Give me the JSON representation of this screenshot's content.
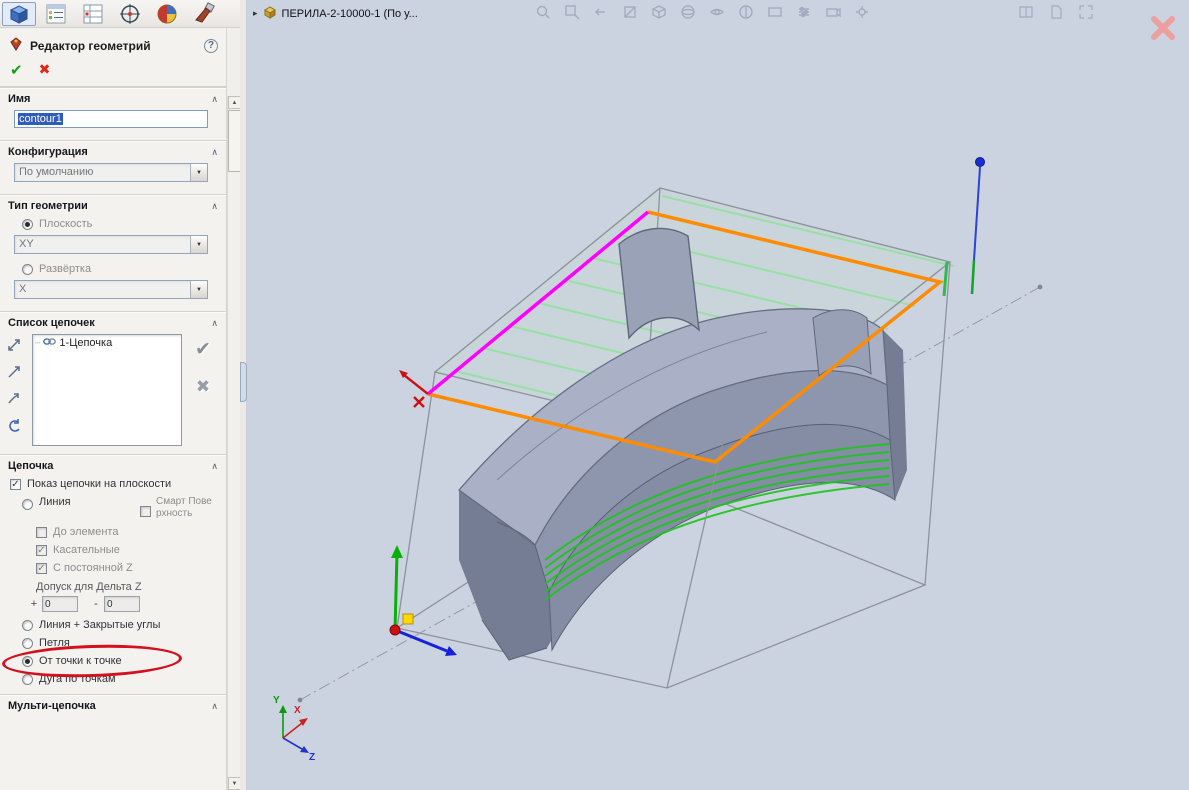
{
  "glyphs": {
    "chevron_up": "∧",
    "dropdown": "▼",
    "scroll_up": "▲",
    "scroll_down": "▼",
    "expand": "▸",
    "help": "?",
    "ok": "✔",
    "cancel": "✖",
    "accept": "✔",
    "delete": "✖",
    "plus": "+",
    "minus": "-",
    "tree_dots": "┄"
  },
  "panel": {
    "title": "Редактор геометрий",
    "sections": {
      "name": {
        "label": "Имя",
        "value": "contour1"
      },
      "configuration": {
        "label": "Конфигурация",
        "value": "По умолчанию"
      },
      "geometry_type": {
        "label": "Тип геометрии",
        "plane_option": "Плоскость",
        "plane_value": "XY",
        "unfold_option": "Развёртка",
        "unfold_value": "X"
      },
      "chain_list": {
        "label": "Список цепочек",
        "items": [
          "1-Цепочка"
        ]
      },
      "chain": {
        "label": "Цепочка",
        "show_on_plane": "Показ цепочки на плоскости",
        "line": "Линия",
        "smart_surface": "Смарт Поверхность",
        "to_element": "До элемента",
        "tangent": "Касательные",
        "constant_z": "С постоянной Z",
        "delta_z": "Допуск для Дельта Z",
        "plus_value": "0",
        "minus_value": "0",
        "line_closed_corners": "Линия + Закрытые углы",
        "loop": "Петля",
        "point_to_point": "От точки к точке",
        "arc_by_points": "Дуга по точкам"
      },
      "multi_chain": {
        "label": "Мульти-цепочка"
      }
    }
  },
  "viewport": {
    "document_label": "ПЕРИЛА-2-10000-1  (По у...",
    "triad": {
      "x": "X",
      "y": "Y",
      "z": "Z"
    }
  },
  "colors": {
    "viewport_bg": "#ccd3e0",
    "orange_contour": "#ff8c00",
    "magenta_edge": "#ff00ff",
    "green_wire": "#22c43a",
    "selection_blue": "#2f5bbd",
    "annotation_red": "#d40f1e"
  }
}
